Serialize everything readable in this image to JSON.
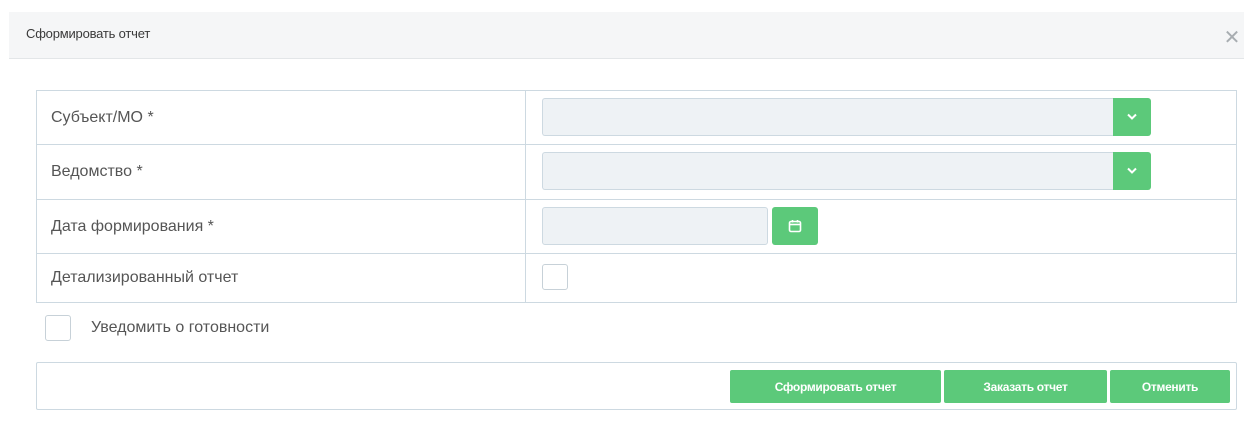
{
  "dialog": {
    "title": "Сформировать отчет",
    "close_glyph": "✕"
  },
  "form": {
    "rows": [
      {
        "label": "Субъект/МО *",
        "control": "select",
        "value": ""
      },
      {
        "label": "Ведомство *",
        "control": "select",
        "value": ""
      },
      {
        "label": "Дата формирования *",
        "control": "date",
        "value": ""
      },
      {
        "label": "Детализированный отчет",
        "control": "checkbox",
        "checked": false
      }
    ]
  },
  "notify": {
    "label": "Уведомить о готовности",
    "checked": false
  },
  "footer": {
    "generate_label": "Сформировать отчет",
    "order_label": "Заказать отчет",
    "cancel_label": "Отменить"
  },
  "colors": {
    "accent": "#5cc97a",
    "header_bg": "#f5f6f7",
    "border": "#cdd9e1",
    "input_bg": "#eef2f5"
  },
  "icons": {
    "select": "chevron-down-icon",
    "date": "calendar-icon",
    "close": "close-icon"
  }
}
